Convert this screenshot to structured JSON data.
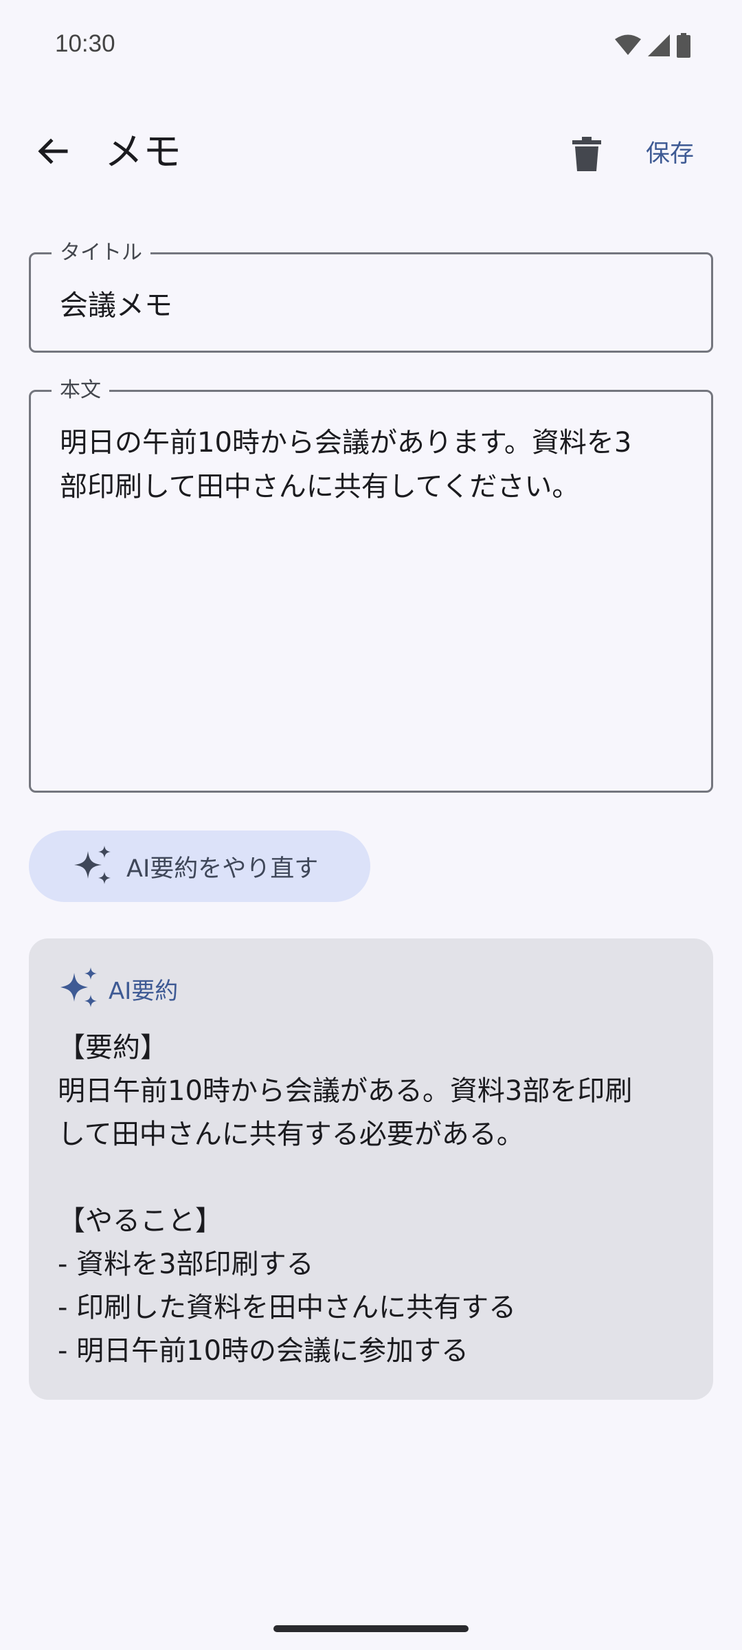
{
  "status_bar": {
    "time": "10:30",
    "icons": [
      "wifi-icon",
      "signal-icon",
      "battery-icon"
    ]
  },
  "app_bar": {
    "back_icon": "arrow-back-icon",
    "title": "メモ",
    "delete_icon": "trash-icon",
    "save_label": "保存"
  },
  "title_field": {
    "label": "タイトル",
    "value": "会議メモ"
  },
  "body_field": {
    "label": "本文",
    "value": "明日の午前10時から会議があります。資料を3\n部印刷して田中さんに共有してください。"
  },
  "ai_button": {
    "icon": "sparkle-icon",
    "label": "AI要約をやり直す"
  },
  "summary": {
    "icon": "sparkle-icon",
    "title": "AI要約",
    "text": "【要約】\n明日午前10時から会議がある。資料3部を印刷\nして田中さんに共有する必要がある。\n\n【やること】\n- 資料を3部印刷する\n- 印刷した資料を田中さんに共有する\n- 明日午前10時の会議に参加する"
  },
  "colors": {
    "background": "#f7f6fc",
    "accent": "#3e5a94",
    "button_container": "#dce2f9",
    "card": "#e2e2e8"
  }
}
